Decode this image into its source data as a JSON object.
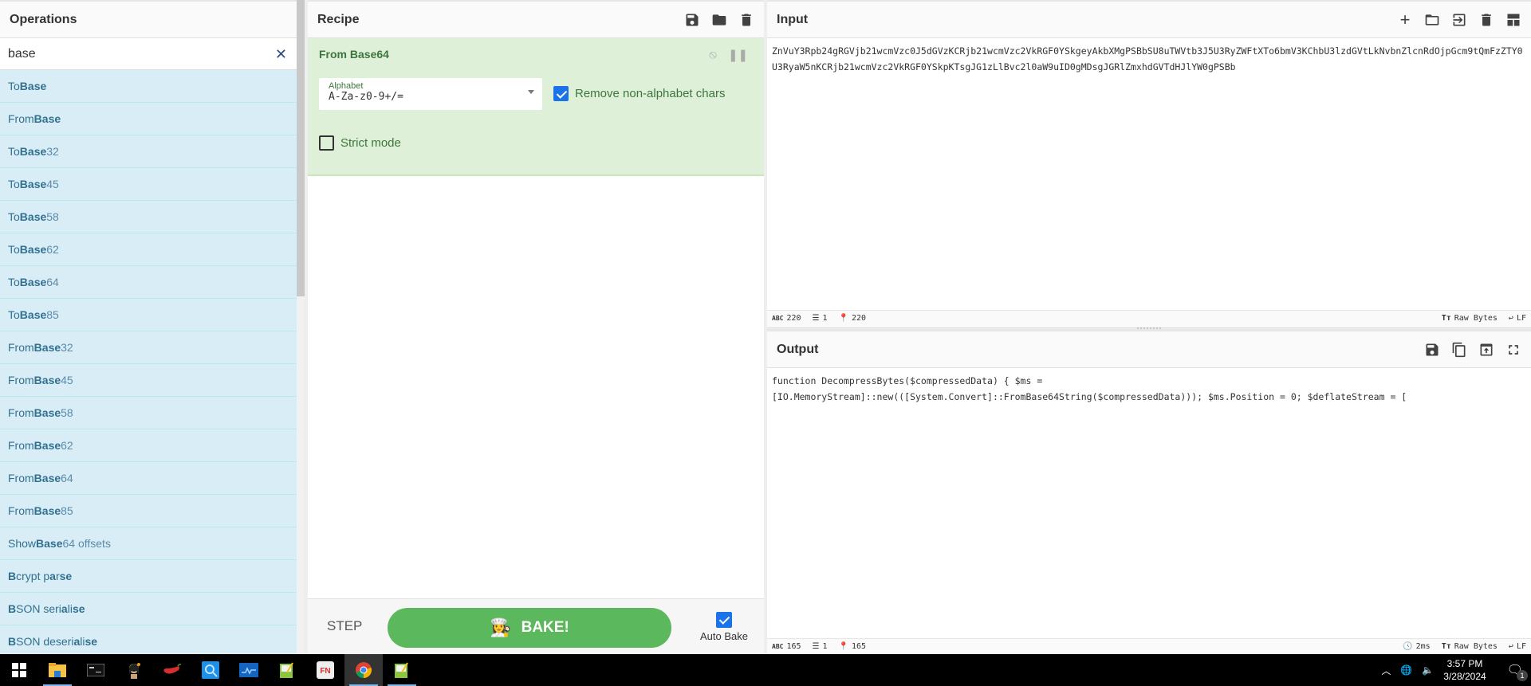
{
  "operations": {
    "title": "Operations",
    "search_value": "base",
    "search_clear_icon": "close-icon",
    "items": [
      {
        "pre": "To ",
        "bold": "Base",
        "post": ""
      },
      {
        "pre": "From ",
        "bold": "Base",
        "post": ""
      },
      {
        "pre": "To ",
        "bold": "Base",
        "post": "32"
      },
      {
        "pre": "To ",
        "bold": "Base",
        "post": "45"
      },
      {
        "pre": "To ",
        "bold": "Base",
        "post": "58"
      },
      {
        "pre": "To ",
        "bold": "Base",
        "post": "62"
      },
      {
        "pre": "To ",
        "bold": "Base",
        "post": "64"
      },
      {
        "pre": "To ",
        "bold": "Base",
        "post": "85"
      },
      {
        "pre": "From ",
        "bold": "Base",
        "post": "32"
      },
      {
        "pre": "From ",
        "bold": "Base",
        "post": "45"
      },
      {
        "pre": "From ",
        "bold": "Base",
        "post": "58"
      },
      {
        "pre": "From ",
        "bold": "Base",
        "post": "62"
      },
      {
        "pre": "From ",
        "bold": "Base",
        "post": "64"
      },
      {
        "pre": "From ",
        "bold": "Base",
        "post": "85"
      },
      {
        "pre": "Show ",
        "bold": "Base",
        "post": "64 offsets"
      },
      {
        "html": "<b>B</b>crypt p<b>a</b>r<b>se</b>"
      },
      {
        "html": "<b>B</b>SON seri<b>a</b>li<b>se</b>"
      },
      {
        "html": "<b>B</b>SON deseri<b>a</b>li<b>se</b>"
      }
    ]
  },
  "recipe": {
    "title": "Recipe",
    "icons": [
      "save-icon",
      "folder-icon",
      "trash-icon"
    ],
    "operation": {
      "name": "From Base64",
      "alphabet_label": "Alphabet",
      "alphabet_value": "A-Za-z0-9+/=",
      "remove_non_alphabet_label": "Remove non-alphabet chars",
      "remove_non_alphabet_checked": true,
      "strict_mode_label": "Strict mode",
      "strict_mode_checked": false
    },
    "step_label": "STEP",
    "bake_label": "BAKE!",
    "auto_bake_label": "Auto Bake",
    "auto_bake_checked": true
  },
  "input": {
    "title": "Input",
    "icons": [
      "plus-icon",
      "folder-icon",
      "import-icon",
      "trash-icon",
      "layout-icon"
    ],
    "text": "ZnVuY3Rpb24gRGVjb21wcmVzc0J5dGVzKCRjb21wcmVzc2VkRGF0YSkgeyAkbXMgPSBbSU8uTWVtb3J5U3RyZWFtXTo6bmV3KChbU3lzdGVtLkNvbnZlcnRdOjpGcm9tQmFzZTY0U3RyaW5nKCRjb21wcmVzc2VkRGF0YSkpKTsgJG1zLlBvc2l0aW9uID0gMDsgJGRlZmxhdGVTdHJlYW0gPSBb",
    "status": {
      "chars": "220",
      "lines": "1",
      "position": "220",
      "encoding": "Raw Bytes",
      "eol": "LF"
    }
  },
  "output": {
    "title": "Output",
    "icons": [
      "save-icon",
      "copy-icon",
      "replace-input-icon",
      "maximise-icon"
    ],
    "line1": "function DecompressBytes($compressedData) { $ms =",
    "line2": "[IO.MemoryStream]::new(([System.Convert]::FromBase64String($compressedData))); $ms.Position = 0; $deflateStream = [",
    "status": {
      "chars": "165",
      "lines": "1",
      "position": "165",
      "time": "2ms",
      "encoding": "Raw Bytes",
      "eol": "LF"
    }
  },
  "taskbar": {
    "apps": [
      "start-icon",
      "file-explorer-icon",
      "terminal-icon",
      "portrait-app-icon",
      "chili-app-icon",
      "search-app-icon",
      "monitor-app-icon",
      "notepad-icon",
      "fn-app-icon",
      "chrome-icon",
      "notepad-icon"
    ],
    "time": "3:57 PM",
    "date": "3/28/2024",
    "notification_count": "1"
  }
}
